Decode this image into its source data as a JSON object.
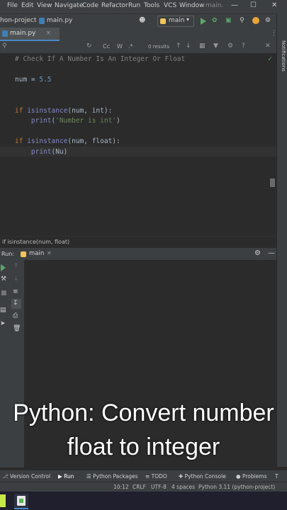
{
  "menu": {
    "items": [
      "File",
      "Edit",
      "View",
      "Navigate",
      "Code",
      "Refactor",
      "Run",
      "Tools",
      "VCS",
      "Window",
      "main."
    ]
  },
  "navbar": {
    "project": "hon-project",
    "file": "main.py",
    "run_config": "main"
  },
  "tab": {
    "label": "main.py"
  },
  "findbar": {
    "results": "0 results",
    "case": "Cc",
    "words": "W"
  },
  "editor": {
    "lines": [
      "# Check If A Number Is An Integer Or Float",
      "num = 5.5",
      "if isinstance(num, int):",
      "    print('Number is int')",
      "if isinstance(num, float):",
      "    print(Nu)"
    ],
    "comment": "# Check If A Number Is An Integer Or Float",
    "assign_var": "num",
    "assign_op": " = ",
    "assign_val": "5.5",
    "if_kw": "if",
    "isinstance": "isinstance",
    "args_int": "(num, int):",
    "args_float": "(num, float):",
    "print": "print",
    "str_int": "'Number is int'",
    "partial": "(Nu)"
  },
  "breadcrumb": "if isinstance(num, float)",
  "run_panel": {
    "label": "Run:",
    "tab": "main"
  },
  "overlay": {
    "line1": "Python: Convert number",
    "line2": "float to integer"
  },
  "bottom_tabs": [
    "Version Control",
    "Run",
    "Python Packages",
    "TODO",
    "Python Console",
    "Problems",
    "T"
  ],
  "status": {
    "position": "10:12",
    "line_sep": "CRLF",
    "encoding": "UTF-8",
    "indent": "4 spaces",
    "interpreter": "Python 3.11 (python-project)"
  },
  "notifications": "Notifications",
  "colors": {
    "accent": "#4a88c7",
    "run_green": "#59a869",
    "keyword": "#cc7832",
    "number": "#6897bb",
    "string": "#6a8759"
  }
}
